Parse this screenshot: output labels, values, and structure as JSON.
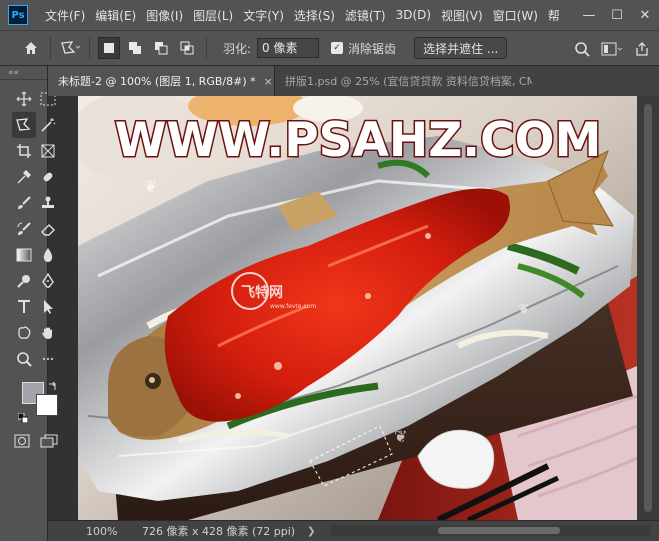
{
  "app": {
    "logo": "Ps"
  },
  "menu": [
    "文件(F)",
    "编辑(E)",
    "图像(I)",
    "图层(L)",
    "文字(Y)",
    "选择(S)",
    "滤镜(T)",
    "3D(D)",
    "视图(V)",
    "窗口(W)",
    "帮"
  ],
  "window_controls": {
    "minimize": "—",
    "maximize": "☐",
    "close": "✕"
  },
  "options": {
    "feather_label": "羽化:",
    "feather_value": "0 像素",
    "antialias_label": "消除锯齿",
    "antialias_checked": true,
    "mask_button": "选择并遮住 ..."
  },
  "tabs": [
    {
      "label": "未标题-2 @ 100% (图层 1, RGB/8#) *",
      "close": "×",
      "active": true
    },
    {
      "label": "拼版1.psd @ 25% (宜信贷贷款 资料信贷档案, CM...",
      "active": false
    }
  ],
  "canvas": {
    "watermark": "WWW.PSAHZ.COM",
    "stamp_text": "飞特网",
    "stamp_sub": "www.fevte.com"
  },
  "colors": {
    "foreground": "#a1a5aa",
    "background": "#ffffff",
    "watermark_fill": "#ffffff",
    "watermark_stroke": "#6b1010"
  },
  "status": {
    "zoom": "100%",
    "doc_info": "726 像素 x 428 像素 (72 ppi)",
    "arrow": "❯"
  },
  "toolbar": {
    "collapse": "««"
  }
}
